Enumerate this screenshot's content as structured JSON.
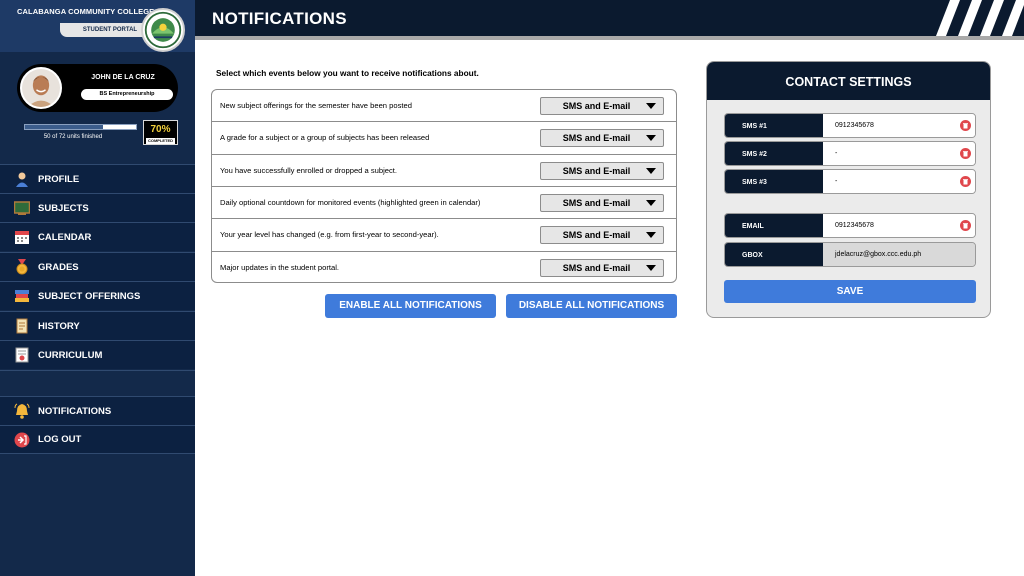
{
  "sidebar": {
    "college_name": "CALABANGA COMMUNITY COLLEGE",
    "portal_label": "STUDENT PORTAL",
    "student_name": "JOHN DE LA CRUZ",
    "program": "BS Entrepreneurship",
    "progress": {
      "fraction": 0.7,
      "units_text": "50 of 72 units finished",
      "percent_text": "70%",
      "completed_label": "COMPLETED"
    },
    "nav": [
      {
        "label": "PROFILE",
        "icon": "profile-icon"
      },
      {
        "label": "SUBJECTS",
        "icon": "chalkboard-icon"
      },
      {
        "label": "CALENDAR",
        "icon": "calendar-icon"
      },
      {
        "label": "GRADES",
        "icon": "medal-icon"
      },
      {
        "label": "SUBJECT OFFERINGS",
        "icon": "books-icon"
      },
      {
        "label": "HISTORY",
        "icon": "scroll-icon"
      },
      {
        "label": "CURRICULUM",
        "icon": "certificate-icon"
      }
    ],
    "nav_bottom": [
      {
        "label": "NOTIFICATIONS",
        "icon": "bell-icon"
      },
      {
        "label": "LOG OUT",
        "icon": "logout-icon"
      }
    ]
  },
  "header": {
    "title": "NOTIFICATIONS"
  },
  "main": {
    "intro": "Select which events below you want to receive notifications about.",
    "events": [
      {
        "text": "New subject offerings for the semester have been posted",
        "option": "SMS and E-mail"
      },
      {
        "text": "A grade for a subject or a group of subjects has been released",
        "option": "SMS and E-mail"
      },
      {
        "text": "You have successfully enrolled or dropped a subject.",
        "option": "SMS and E-mail"
      },
      {
        "text": "Daily optional countdown for monitored events (highlighted green in calendar)",
        "option": "SMS and E-mail"
      },
      {
        "text": "Your year level has changed (e.g. from first-year to second-year).",
        "option": "SMS and E-mail"
      },
      {
        "text": "Major updates in the student portal.",
        "option": "SMS and E-mail"
      }
    ],
    "enable_all": "ENABLE ALL NOTIFICATIONS",
    "disable_all": "DISABLE ALL NOTIFICATIONS"
  },
  "contact": {
    "title": "CONTACT SETTINGS",
    "sms1": {
      "label": "SMS #1",
      "value": "0912345678"
    },
    "sms2": {
      "label": "SMS #2",
      "value": "-"
    },
    "sms3": {
      "label": "SMS #3",
      "value": "-"
    },
    "email": {
      "label": "EMAIL",
      "value": "0912345678"
    },
    "gbox": {
      "label": "GBOX",
      "value": "jdelacruz@gbox.ccc.edu.ph"
    },
    "save": "SAVE"
  },
  "colors": {
    "navy": "#0b1a2f",
    "sidebar": "#13294a",
    "accent_blue": "#3f7bdb",
    "delete_red": "#e0474c",
    "gold": "#f4d23c"
  }
}
